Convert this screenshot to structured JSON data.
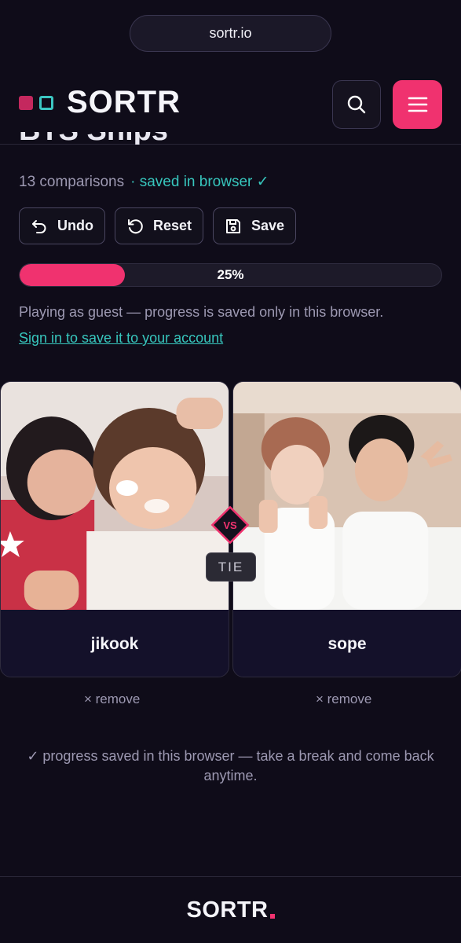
{
  "browser": {
    "url": "sortr.io"
  },
  "header": {
    "logo_text": "SORTR",
    "brand_pink": "#c4285e",
    "brand_teal": "#3cc7c3"
  },
  "page": {
    "title": "BTS Ships",
    "comparisons": "13 comparisons",
    "saved_status": "· saved in browser ✓"
  },
  "actions": {
    "undo": "Undo",
    "reset": "Reset",
    "save": "Save"
  },
  "progress": {
    "value": 0.25,
    "label": "25%"
  },
  "guest": {
    "message": "Playing as guest — progress is saved only in this browser.",
    "signin_link": "Sign in to save it to your account"
  },
  "comparison": {
    "left": {
      "name": "jikook",
      "remove": "× remove"
    },
    "right": {
      "name": "sope",
      "remove": "× remove"
    },
    "vs": "VS",
    "tie": "TIE"
  },
  "note": "✓ progress saved in this browser — take a break and come back anytime.",
  "footer": {
    "logo_text": "SORTR"
  },
  "colors": {
    "accent": "#f0326f",
    "teal": "#37c6bd",
    "background": "#0f0c19"
  }
}
